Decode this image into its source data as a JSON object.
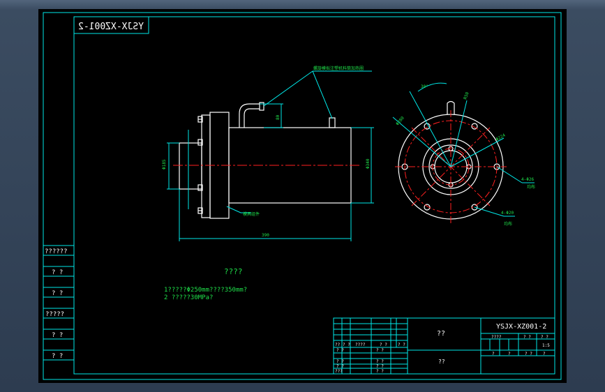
{
  "colors": {
    "border": "#00e8e8",
    "part": "#ffffff",
    "centerline": "#ff2020",
    "dimension": "#00e8e8",
    "text": "#20e040",
    "background": "#000000"
  },
  "drawing": {
    "stamp_mirrored": "YSJX-XZ001-2",
    "leader_note_top": "螺旋模拟注塑机料筒加热圈",
    "leader_note_bottom": "模具组件",
    "side_dims": {
      "left_dia": "Φ185",
      "top_offset": "80",
      "body_dia": "Φ340",
      "length": "390"
    },
    "flange_dims": {
      "angle": "30°",
      "radius": "R50",
      "pcd_outer": "Φ280",
      "pcd_inner": "Φ224",
      "holes_outer": "4-Φ26",
      "holes_outer_note": "均布",
      "holes_inner": "4-Φ20",
      "holes_inner_note": "均布"
    },
    "notes_title": "????",
    "notes": [
      "1?????Φ250mm????350mm?",
      "2 ?????30MPa?"
    ]
  },
  "left_column": [
    "??????",
    "? ?",
    "? ?",
    "?????",
    "? ?",
    "? ?"
  ],
  "title_block": {
    "drawing_no": "YSJX-XZ001-2",
    "name_top": "??",
    "name_bottom": "??",
    "scale": "1:5",
    "head_cells": [
      "????",
      "? ?",
      "? ?"
    ],
    "foot_cells": [
      "?",
      "?",
      "? ?",
      "?"
    ],
    "rev_cells": [
      "??",
      "? ?",
      "????",
      "? ?",
      "? ?"
    ],
    "sign_rows": [
      "? ?",
      "? ?",
      "? ?",
      "???"
    ],
    "sign_cells": [
      "? ?",
      "? ?",
      "? ?",
      "? ?"
    ]
  }
}
